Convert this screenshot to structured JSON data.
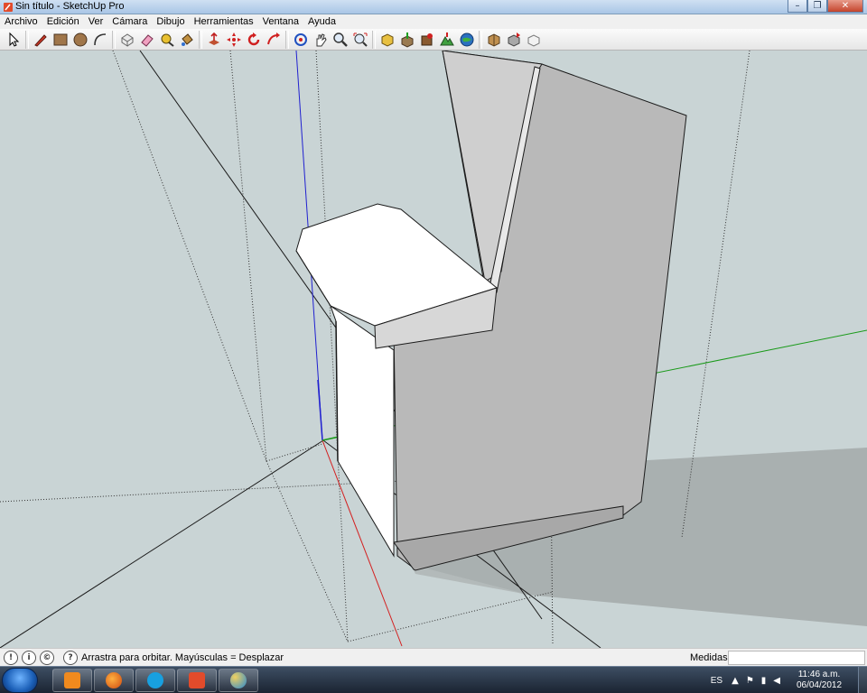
{
  "window": {
    "title": "Sin título - SketchUp Pro",
    "minimize_glyph": "–",
    "maximize_glyph": "❐",
    "close_glyph": "✕"
  },
  "menu": [
    "Archivo",
    "Edición",
    "Ver",
    "Cámara",
    "Dibujo",
    "Herramientas",
    "Ventana",
    "Ayuda"
  ],
  "toolbar": {
    "tools": [
      "select-icon",
      "pencil-icon",
      "rectangle-icon",
      "circle-icon",
      "arc-icon",
      "make-component-icon",
      "eraser-icon",
      "tape-measure-icon",
      "paint-bucket-icon",
      "push-pull-icon",
      "move-icon",
      "rotate-icon",
      "follow-me-icon",
      "orbit-icon",
      "pan-icon",
      "zoom-icon",
      "zoom-extents-icon",
      "get-models-icon",
      "share-model-icon",
      "add-location-icon",
      "toggle-terrain-icon",
      "preview-google-earth-icon",
      "get-photo-texture-icon",
      "share-component-icon",
      "warehouse-icon"
    ]
  },
  "statusbar": {
    "hint": "Arrastra para orbitar. Mayúsculas = Desplazar",
    "measure_label": "Medidas",
    "measure_value": "",
    "status_glyph_1": "!",
    "status_glyph_2": "i",
    "status_glyph_3": "©",
    "help_glyph": "?"
  },
  "taskbar": {
    "apps": [
      "media-player-icon",
      "firefox-icon",
      "skype-icon",
      "sketchup-icon",
      "paint-icon"
    ],
    "language": "ES",
    "time": "11:46 a.m.",
    "date": "06/04/2012"
  },
  "colors": {
    "sky": "#c9d4d5",
    "ground": "#c9d4d5",
    "face_front": "#ffffff",
    "face_side": "#b9b9b9",
    "shadow": "#a9b0b0",
    "axis_red": "#d42020",
    "axis_green": "#1a9a1a",
    "axis_blue": "#2020d0"
  }
}
